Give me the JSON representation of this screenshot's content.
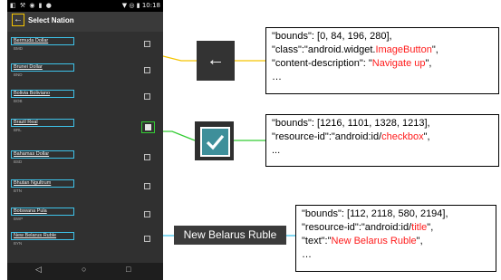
{
  "status_bar": {
    "left_icons": "◧ ⚒ ◉ ▮ ●",
    "right": "▼ ◎ ▮ 10:18"
  },
  "app_bar": {
    "back_glyph": "←",
    "title": "Select Nation"
  },
  "currencies": [
    {
      "name": "Bermuda Dollar",
      "code": "BMD",
      "checked": false
    },
    {
      "name": "Brunei Dollar",
      "code": "BND",
      "checked": false
    },
    {
      "name": "Bolivia Boliviano",
      "code": "BOB",
      "checked": false
    },
    {
      "name": "Brazil Real",
      "code": "BRL",
      "checked": true
    },
    {
      "name": "Bahamas Dollar",
      "code": "BSD",
      "checked": false
    },
    {
      "name": "Bhutan Ngultrum",
      "code": "BTN",
      "checked": false
    },
    {
      "name": "Botswana Pula",
      "code": "BWP",
      "checked": false
    },
    {
      "name": "New Belarus Ruble",
      "code": "BYN",
      "checked": false
    }
  ],
  "nav_bar": {
    "back": "◁",
    "home": "○",
    "recents": "□"
  },
  "callouts": {
    "back_zoom_glyph": "←",
    "title_zoom_text": "New Belarus Ruble",
    "back_panel": {
      "l1": "\"bounds\": [0, 84, 196, 280],",
      "l2a": "\"class\":\"android.widget.",
      "l2b": "ImageButton",
      "l2c": "\",",
      "l3a": "\"content-description\": \"",
      "l3b": "Navigate up",
      "l3c": "\",",
      "l4": "…"
    },
    "check_panel": {
      "l1": "\"bounds\": [1216, 1101, 1328, 1213],",
      "l2a": "\"resource-id\":\"android:id/",
      "l2b": "checkbox",
      "l2c": "\",",
      "l3": "..."
    },
    "title_panel": {
      "l1": "\"bounds\": [112, 2118, 580, 2194],",
      "l2a": "\"resource-id\":\"android:id/",
      "l2b": "title",
      "l2c": "\",",
      "l3a": "\"text\":\"",
      "l3b": "New Belarus Ruble",
      "l3c": "\",",
      "l4": "…"
    }
  },
  "colors": {
    "back_highlight": "#f5c400",
    "checkbox_highlight": "#33cc33",
    "title_highlight": "#3ec3ea",
    "field_red": "#ff1b1b"
  }
}
